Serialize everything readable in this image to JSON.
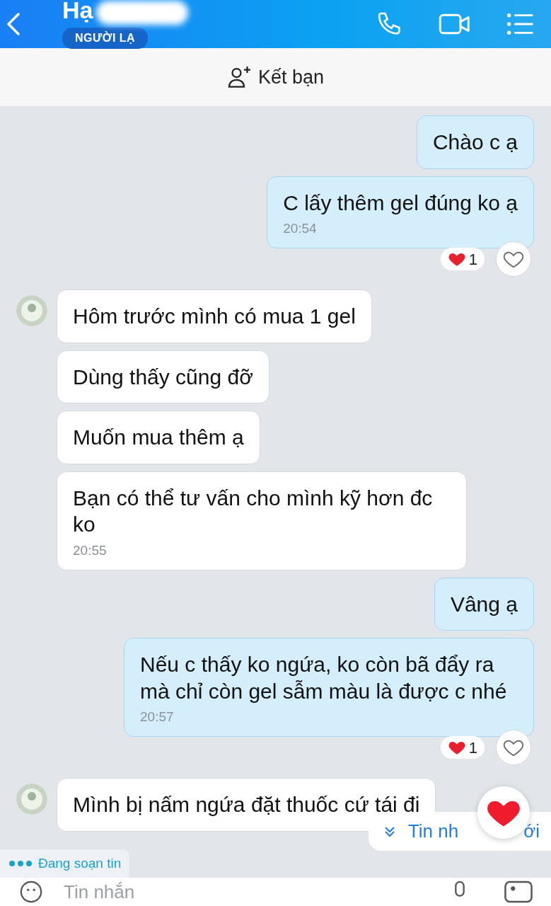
{
  "header": {
    "name": "Hạ",
    "badge": "NGƯỜI LẠ"
  },
  "add_friend": {
    "label": "Kết bạn"
  },
  "groups": [
    {
      "kind": "sent",
      "messages": [
        {
          "text": "Chào c ạ"
        },
        {
          "text": "C lấy thêm gel đúng ko ạ",
          "time": "20:54",
          "reaction": {
            "count": "1"
          }
        }
      ]
    },
    {
      "kind": "received",
      "messages": [
        {
          "text": "Hôm trước mình có mua 1 gel"
        },
        {
          "text": "Dùng thấy cũng đỡ"
        },
        {
          "text": "Muốn mua thêm ạ"
        },
        {
          "text": "Bạn có thể tư vấn cho mình kỹ hơn đc ko",
          "time": "20:55"
        }
      ]
    },
    {
      "kind": "sent",
      "messages": [
        {
          "text": "Vâng ạ"
        },
        {
          "text": "Nếu c thấy ko ngứa, ko còn bã đẩy ra mà chỉ còn gel sẫm màu là được c nhé",
          "time": "20:57",
          "reaction": {
            "count": "1"
          }
        }
      ]
    },
    {
      "kind": "received",
      "messages": [
        {
          "text": "Mình bị nấm ngứa đặt thuốc cứ tái đi"
        }
      ]
    }
  ],
  "typing": {
    "text": "Đang soạn tin"
  },
  "new_messages": {
    "left": "Tin nh",
    "right": "ới"
  },
  "composer": {
    "placeholder": "Tin nhắn"
  }
}
